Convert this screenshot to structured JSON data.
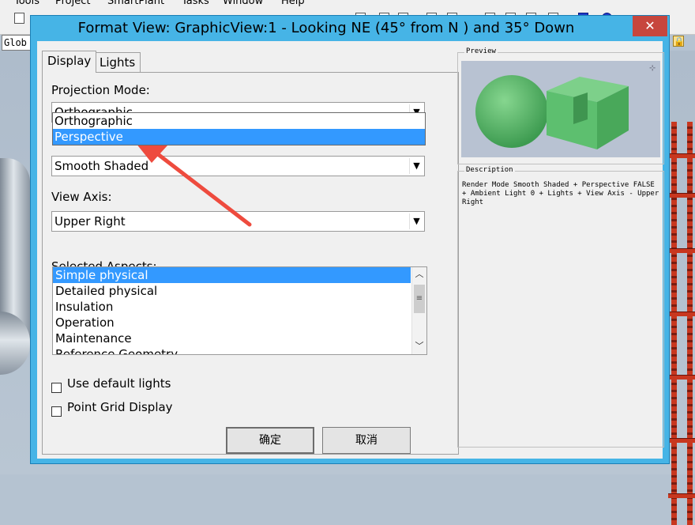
{
  "app": {
    "menu": [
      "Tools",
      "Project",
      "SmartPlant",
      "Tasks",
      "Window",
      "Help"
    ],
    "combo_value": "Glob"
  },
  "dialog": {
    "title": "Format View: GraphicView:1 - Looking NE (45° from N ) and 35° Down",
    "close_glyph": "✕",
    "tabs": [
      "Display",
      "Lights"
    ],
    "projection": {
      "label": "Projection Mode:",
      "value": "Orthographic",
      "options": [
        "Orthographic",
        "Perspective"
      ],
      "selected_option": "Perspective"
    },
    "render_mode": {
      "value": "Smooth Shaded"
    },
    "view_axis": {
      "label": "View Axis:",
      "value": "Upper Right"
    },
    "aspects": {
      "label": "Selected Aspects:",
      "items": [
        "Simple physical",
        "Detailed physical",
        "Insulation",
        "Operation",
        "Maintenance",
        "Reference Geometry"
      ],
      "selected": "Simple physical"
    },
    "checkboxes": {
      "default_lights": "Use default lights",
      "point_grid": "Point Grid Display"
    },
    "preview": {
      "caption": "Preview"
    },
    "description": {
      "caption": "Description",
      "text": "Render Mode Smooth Shaded + Perspective FALSE + Ambient Light 0 + Lights + View Axis - Upper Right"
    },
    "buttons": {
      "ok": "确定",
      "cancel": "取消"
    }
  },
  "colors": {
    "title_bar": "#46b4e6",
    "close": "#c7463d",
    "selection": "#3399ff",
    "annotation_arrow": "#ee4b3e",
    "preview_shape": "#5dbf6f"
  }
}
